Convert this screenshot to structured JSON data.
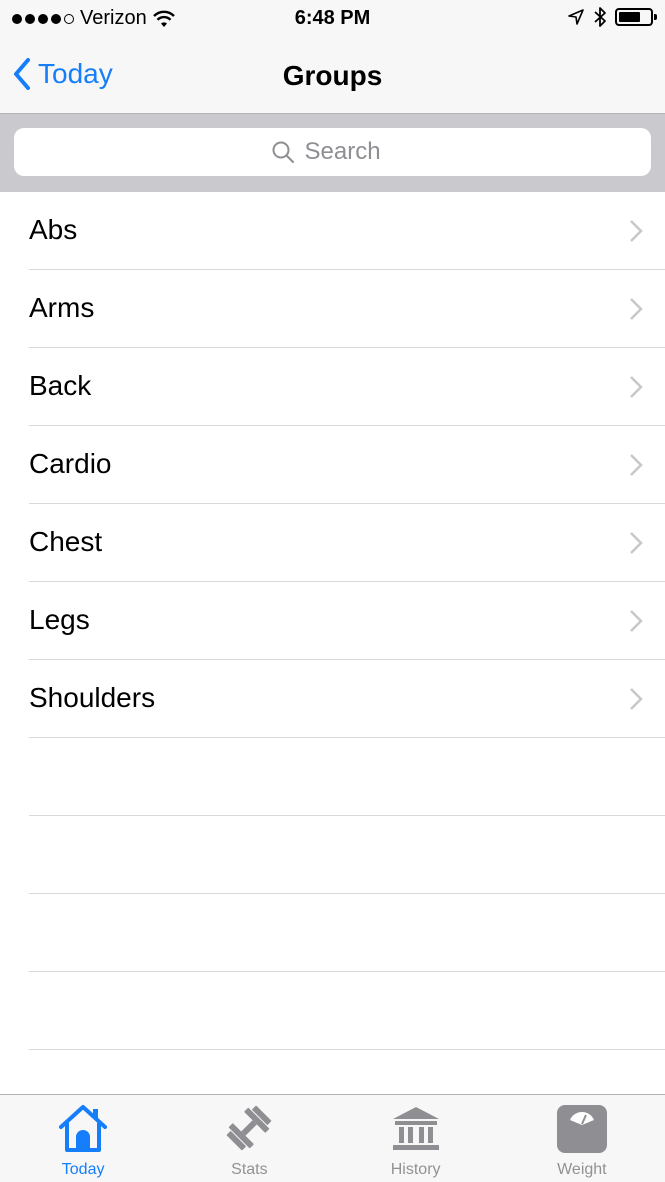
{
  "status_bar": {
    "carrier": "Verizon",
    "time": "6:48 PM",
    "signal_bars_filled": 4,
    "signal_bars_total": 5,
    "battery_level": 0.7
  },
  "nav": {
    "back_label": "Today",
    "title": "Groups"
  },
  "search": {
    "placeholder": "Search"
  },
  "groups": [
    {
      "label": "Abs"
    },
    {
      "label": "Arms"
    },
    {
      "label": "Back"
    },
    {
      "label": "Cardio"
    },
    {
      "label": "Chest"
    },
    {
      "label": "Legs"
    },
    {
      "label": "Shoulders"
    }
  ],
  "tabs": [
    {
      "label": "Today",
      "icon": "home-icon",
      "active": true
    },
    {
      "label": "Stats",
      "icon": "dumbbell-icon",
      "active": false
    },
    {
      "label": "History",
      "icon": "building-icon",
      "active": false
    },
    {
      "label": "Weight",
      "icon": "scale-icon",
      "active": false
    }
  ],
  "colors": {
    "accent": "#147efb",
    "inactive": "#929292",
    "separator": "#d9d9dc"
  }
}
